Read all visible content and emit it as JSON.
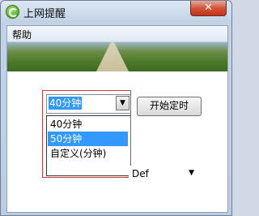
{
  "window": {
    "title": "上网提醒",
    "close_label": "✕"
  },
  "menu": {
    "help": "帮助"
  },
  "dropdown": {
    "selected": "40分钟",
    "arrow": "▼",
    "options": [
      {
        "label": "40分钟",
        "selected": false
      },
      {
        "label": "50分钟",
        "selected": true
      },
      {
        "label": "自定义(分钟)",
        "selected": false
      }
    ]
  },
  "start_button": {
    "label": "开始定时"
  },
  "second_combo": {
    "value": "Def",
    "arrow": "▼"
  },
  "icons": {
    "app": "refresh-icon",
    "close": "close-icon",
    "dropdown": "chevron-down-icon"
  },
  "colors": {
    "selection": "#3399ff",
    "highlight_frame": "#d43b3b",
    "close": "#c4321a"
  }
}
